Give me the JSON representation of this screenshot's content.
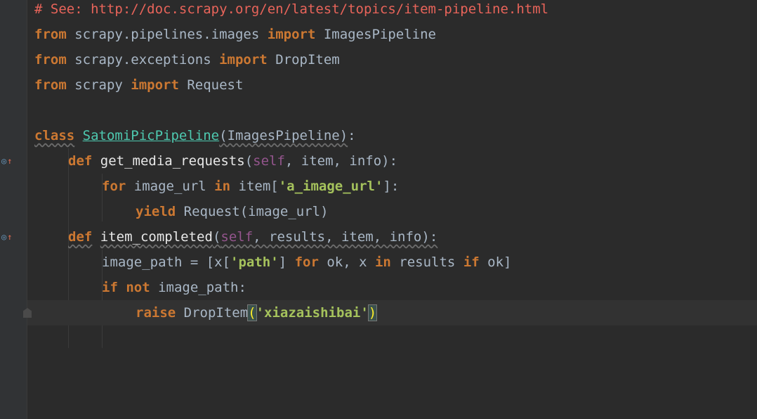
{
  "editor": {
    "lines": [
      {
        "indent": 0,
        "tokens": [
          {
            "t": "# See: http://doc.scrapy.org/en/latest/topics/item-pipeline.html",
            "c": "comment"
          }
        ]
      },
      {
        "indent": 0,
        "tokens": [
          {
            "t": "from",
            "c": "kw"
          },
          {
            "t": " scrapy.pipelines.images ",
            "c": "plain"
          },
          {
            "t": "import",
            "c": "kw"
          },
          {
            "t": " ImagesPipeline",
            "c": "plain"
          }
        ]
      },
      {
        "indent": 0,
        "tokens": [
          {
            "t": "from",
            "c": "kw"
          },
          {
            "t": " scrapy.exceptions ",
            "c": "plain"
          },
          {
            "t": "import",
            "c": "kw"
          },
          {
            "t": " DropItem",
            "c": "plain"
          }
        ]
      },
      {
        "indent": 0,
        "tokens": [
          {
            "t": "from",
            "c": "kw"
          },
          {
            "t": " scrapy ",
            "c": "plain"
          },
          {
            "t": "import",
            "c": "kw"
          },
          {
            "t": " Request",
            "c": "plain"
          }
        ]
      },
      {
        "indent": 0,
        "tokens": []
      },
      {
        "indent": 0,
        "tokens": [
          {
            "t": "class",
            "c": "kw wavy"
          },
          {
            "t": " ",
            "c": "plain"
          },
          {
            "t": "SatomiPicPipeline",
            "c": "cls"
          },
          {
            "t": "(ImagesPipeline)",
            "c": "plain wavy"
          },
          {
            "t": ":",
            "c": "plain"
          }
        ]
      },
      {
        "indent": 1,
        "tokens": [
          {
            "t": "def",
            "c": "kw"
          },
          {
            "t": " ",
            "c": "plain"
          },
          {
            "t": "get_media_requests",
            "c": "method"
          },
          {
            "t": "(",
            "c": "plain"
          },
          {
            "t": "self",
            "c": "self"
          },
          {
            "t": ", item, info):",
            "c": "plain"
          }
        ]
      },
      {
        "indent": 2,
        "tokens": [
          {
            "t": "for",
            "c": "kw"
          },
          {
            "t": " image_url ",
            "c": "plain"
          },
          {
            "t": "in",
            "c": "kw"
          },
          {
            "t": " item[",
            "c": "plain"
          },
          {
            "t": "'a_image_url'",
            "c": "str-bright"
          },
          {
            "t": "]:",
            "c": "plain"
          }
        ]
      },
      {
        "indent": 3,
        "tokens": [
          {
            "t": "yield",
            "c": "kw"
          },
          {
            "t": " Request(image_url)",
            "c": "plain"
          }
        ]
      },
      {
        "indent": 1,
        "tokens": [
          {
            "t": "def",
            "c": "kw wavy"
          },
          {
            "t": " ",
            "c": "plain"
          },
          {
            "t": "item_completed",
            "c": "method wavy"
          },
          {
            "t": "(",
            "c": "plain wavy"
          },
          {
            "t": "self",
            "c": "self wavy"
          },
          {
            "t": ", results, item, info):",
            "c": "plain wavy"
          }
        ]
      },
      {
        "indent": 2,
        "tokens": [
          {
            "t": "image_path = [x[",
            "c": "plain"
          },
          {
            "t": "'path'",
            "c": "str-bright"
          },
          {
            "t": "] ",
            "c": "plain"
          },
          {
            "t": "for",
            "c": "kw"
          },
          {
            "t": " ok, x ",
            "c": "plain"
          },
          {
            "t": "in",
            "c": "kw"
          },
          {
            "t": " results ",
            "c": "plain"
          },
          {
            "t": "if",
            "c": "kw"
          },
          {
            "t": " ok]",
            "c": "plain"
          }
        ]
      },
      {
        "indent": 2,
        "tokens": [
          {
            "t": "if",
            "c": "kw"
          },
          {
            "t": " ",
            "c": "plain"
          },
          {
            "t": "not",
            "c": "kw"
          },
          {
            "t": " image_path:",
            "c": "plain"
          }
        ]
      },
      {
        "indent": 3,
        "current": true,
        "tokens": [
          {
            "t": "raise",
            "c": "kw"
          },
          {
            "t": " DropItem",
            "c": "plain"
          },
          {
            "t": "(",
            "c": "hl-paren"
          },
          {
            "t": "'xiazaishibai'",
            "c": "str-bright"
          },
          {
            "t": ")",
            "c": "hl-paren"
          }
        ]
      }
    ]
  },
  "gutter": {
    "override_icon": "override-method-icon"
  }
}
